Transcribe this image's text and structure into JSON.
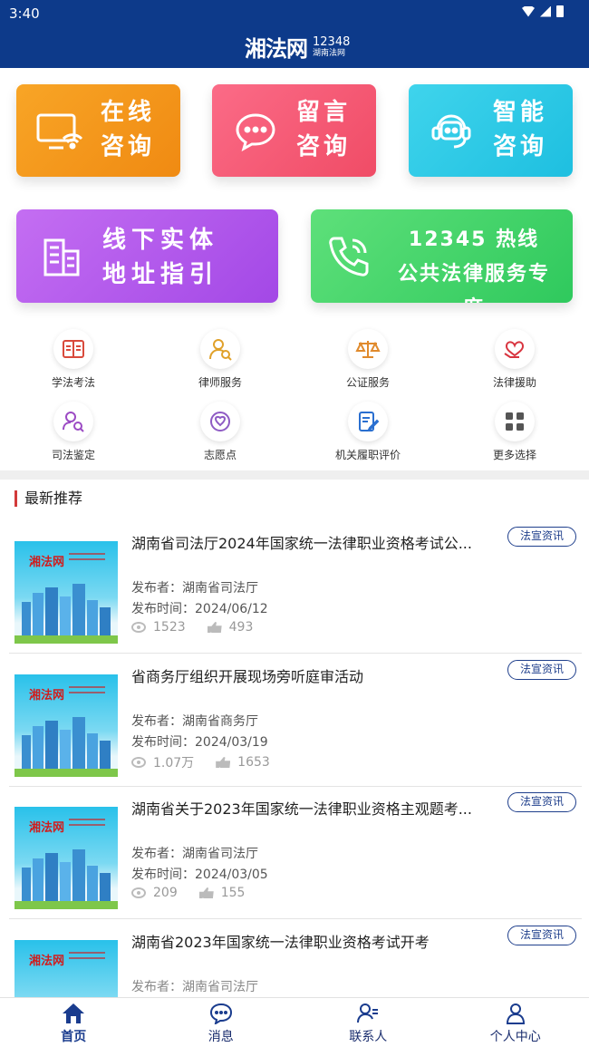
{
  "status_bar": {
    "time": "3:40"
  },
  "header": {
    "logo_main": "湘法网",
    "logo_number": "12348",
    "logo_sub": "湖南法网"
  },
  "tiles": [
    {
      "line1": "在线",
      "line2": "咨询",
      "icon": "monitor-wifi-icon"
    },
    {
      "line1": "留言",
      "line2": "咨询",
      "icon": "chat-bubble-icon"
    },
    {
      "line1": "智能",
      "line2": "咨询",
      "icon": "robot-headset-icon"
    },
    {
      "line1": "线下实体",
      "line2": "地址指引",
      "icon": "building-icon"
    },
    {
      "line1": "12345 热线",
      "line2": "公共法律服务专席",
      "icon": "phone-icon"
    }
  ],
  "quick_grid": [
    {
      "label": "学法考法",
      "icon": "book-icon"
    },
    {
      "label": "律师服务",
      "icon": "lawyer-icon"
    },
    {
      "label": "公证服务",
      "icon": "scales-icon"
    },
    {
      "label": "法律援助",
      "icon": "heart-hand-icon"
    },
    {
      "label": "司法鉴定",
      "icon": "search-person-icon"
    },
    {
      "label": "志愿点",
      "icon": "volunteer-icon"
    },
    {
      "label": "机关履职评价",
      "icon": "edit-document-icon"
    },
    {
      "label": "更多选择",
      "icon": "grid-more-icon"
    }
  ],
  "section": {
    "title": "最新推荐"
  },
  "news": [
    {
      "title": "湖南省司法厅2024年国家统一法律职业资格考试公...",
      "tag": "法宣资讯",
      "publisher": "发布者：湖南省司法厅",
      "time": "发布时间：2024/06/12",
      "views": "1523",
      "likes": "493",
      "thumb_logo": "湘法网"
    },
    {
      "title": "省商务厅组织开展现场旁听庭审活动",
      "tag": "法宣资讯",
      "publisher": "发布者：湖南省商务厅",
      "time": "发布时间：2024/03/19",
      "views": "1.07万",
      "likes": "1653",
      "thumb_logo": "湘法网"
    },
    {
      "title": "湖南省关于2023年国家统一法律职业资格主观题考...",
      "tag": "法宣资讯",
      "publisher": "发布者：湖南省司法厅",
      "time": "发布时间：2024/03/05",
      "views": "209",
      "likes": "155",
      "thumb_logo": "湘法网"
    },
    {
      "title": "湖南省2023年国家统一法律职业资格考试开考",
      "tag": "法宣资讯",
      "publisher": "发布者：湖南省司法厅",
      "time": "",
      "views": "",
      "likes": "",
      "thumb_logo": "湘法网"
    }
  ],
  "bottom_nav": [
    {
      "label": "首页",
      "icon": "home-icon",
      "active": true
    },
    {
      "label": "消息",
      "icon": "message-icon",
      "active": false
    },
    {
      "label": "联系人",
      "icon": "contacts-icon",
      "active": false
    },
    {
      "label": "个人中心",
      "icon": "user-icon",
      "active": false
    }
  ],
  "colors": {
    "header": "#0d3a8a",
    "tile_orange": "#f4971c",
    "tile_pink": "#f5596f",
    "tile_cyan": "#2ac8e6",
    "tile_purple": "#b15bec",
    "tile_green": "#43d36b",
    "accent_red": "#d23a3a",
    "tag_blue": "#1f3f8c"
  }
}
